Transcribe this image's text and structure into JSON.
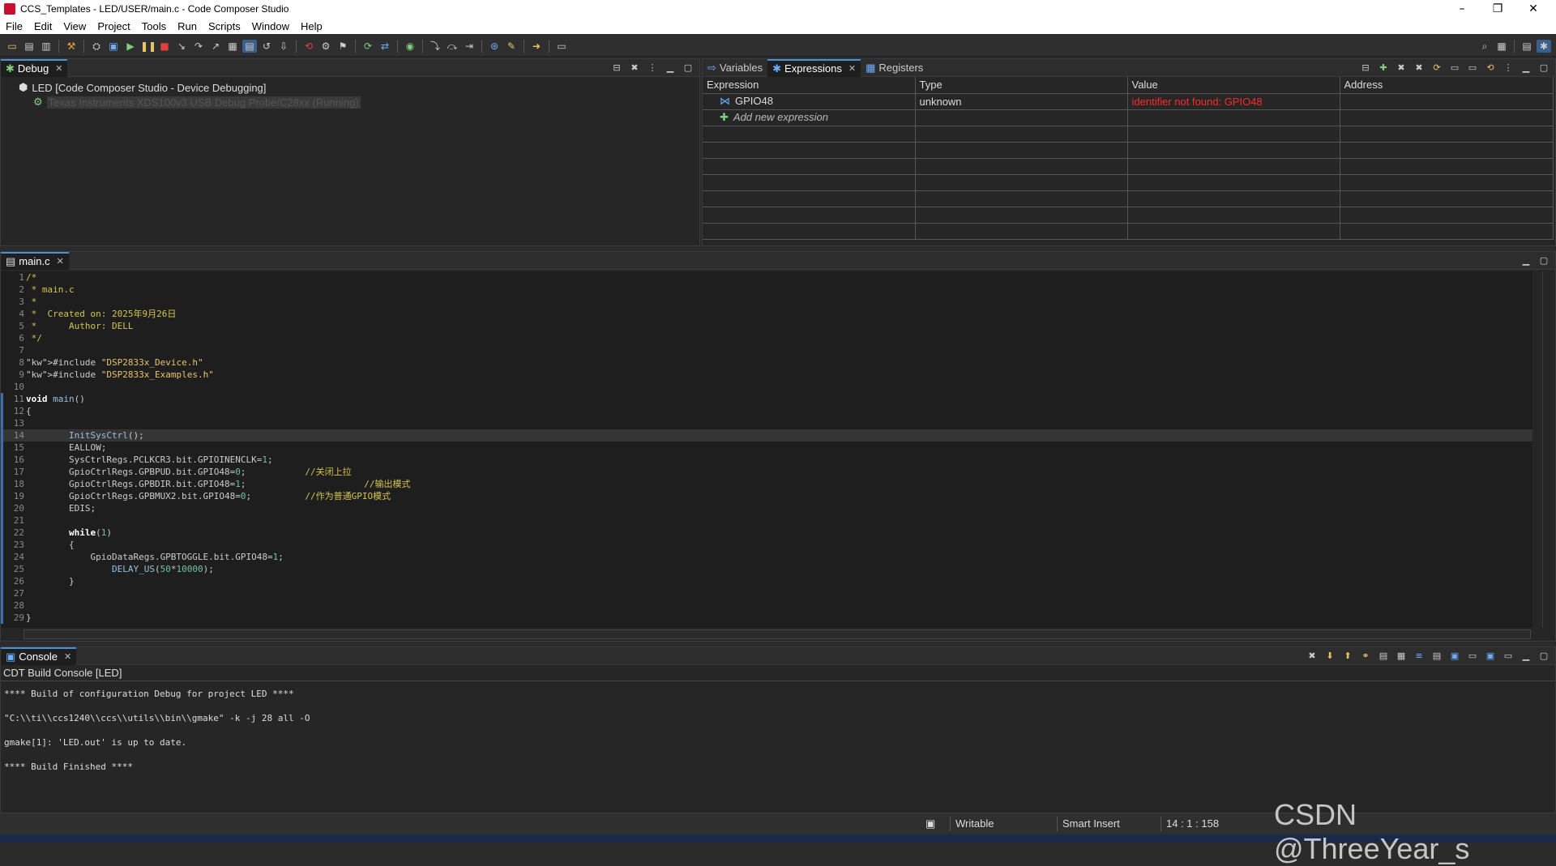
{
  "window": {
    "title": "CCS_Templates - LED/USER/main.c - Code Composer Studio",
    "minimize": "–",
    "maximize": "❐",
    "close": "✕"
  },
  "menu": [
    "File",
    "Edit",
    "View",
    "Project",
    "Tools",
    "Run",
    "Scripts",
    "Window",
    "Help"
  ],
  "debug": {
    "tab": "Debug",
    "items": [
      {
        "label": "LED [Code Composer Studio - Device Debugging]",
        "icon": "debug-session-icon"
      },
      {
        "label": "Texas Instruments XDS100v3 USB Debug Probe/C28xx (Running)",
        "icon": "cpu-running-icon"
      }
    ]
  },
  "expressions": {
    "tabs": [
      "Variables",
      "Expressions",
      "Registers"
    ],
    "columns": [
      "Expression",
      "Type",
      "Value",
      "Address"
    ],
    "rows": [
      {
        "expression": "GPIO48",
        "type": "unknown",
        "value": "identifier not found: GPIO48",
        "address": ""
      }
    ],
    "add_label": "Add new expression"
  },
  "editor": {
    "tab": "main.c",
    "current_line": 14,
    "lines": [
      "/*",
      " * main.c",
      " *",
      " *  Created on: 2025年9月26日",
      " *      Author: DELL",
      " */",
      "",
      "#include \"DSP2833x_Device.h\"",
      "#include \"DSP2833x_Examples.h\"",
      "",
      "void main()",
      "{",
      "",
      "        InitSysCtrl();",
      "        EALLOW;",
      "        SysCtrlRegs.PCLKCR3.bit.GPIOINENCLK=1;",
      "        GpioCtrlRegs.GPBPUD.bit.GPIO48=0;           //关闭上拉",
      "        GpioCtrlRegs.GPBDIR.bit.GPIO48=1;                      //输出模式",
      "        GpioCtrlRegs.GPBMUX2.bit.GPIO48=0;          //作为普通GPIO模式",
      "        EDIS;",
      "",
      "        while(1)",
      "        {",
      "            GpioDataRegs.GPBTOGGLE.bit.GPIO48=1;",
      "                DELAY_US(50*10000);",
      "        }",
      "",
      "",
      "}"
    ]
  },
  "console": {
    "tab": "Console",
    "subtitle": "CDT Build Console [LED]",
    "lines": [
      "**** Build of configuration Debug for project LED ****",
      "\"C:\\\\ti\\\\ccs1240\\\\ccs\\\\utils\\\\bin\\\\gmake\" -k -j 28 all -O",
      "gmake[1]: 'LED.out' is up to date.",
      "**** Build Finished ****"
    ]
  },
  "status": {
    "writable": "Writable",
    "insert_mode": "Smart Insert",
    "position": "14 : 1 : 158"
  },
  "watermark": "CSDN @ThreeYear_s",
  "colors": {
    "accent": "#4a90d9",
    "error": "#ff2a2a",
    "comment": "#d4c44f"
  }
}
